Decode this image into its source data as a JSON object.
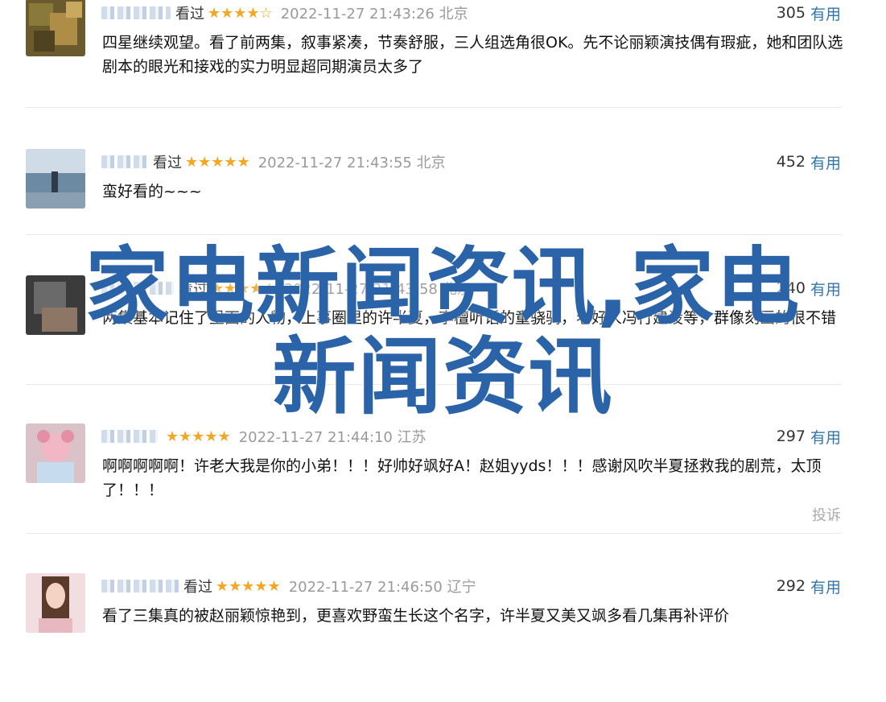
{
  "comments": [
    {
      "watched": "看过",
      "stars": "★★★★☆",
      "time": "2022-11-27 21:43:26 北京",
      "votes": "305",
      "useful": "有用",
      "text": "四星继续观望。看了前两集，叙事紧凑，节奏舒服，三人组选角很OK。先不论丽颖演技偶有瑕疵，她和团队选剧本的眼光和接戏的实力明显超同期演员太多了"
    },
    {
      "watched": "看过",
      "stars": "★★★★★",
      "time": "2022-11-27 21:43:55 北京",
      "votes": "452",
      "useful": "有用",
      "text": "蛮好看的~~~"
    },
    {
      "watched": "看过",
      "stars": "★★★★★",
      "time": "2022-11-27 21:43:58 北京",
      "votes": "240",
      "useful": "有用",
      "text": "两集基本记住了里面的人物，上事圈里的许半夏，李檀听话的童骁骑，老好人冯行建设等，群像刻画的很不错"
    },
    {
      "watched": "",
      "stars": "★★★★★",
      "time": "2022-11-27 21:44:10 江苏",
      "votes": "297",
      "useful": "有用",
      "text": "啊啊啊啊啊！许老大我是你的小弟！！！好帅好飒好A！赵姐yyds！！！感谢风吹半夏拯救我的剧荒，太顶了！！！",
      "report": "投诉"
    },
    {
      "watched": "看过",
      "stars": "★★★★★",
      "time": "2022-11-27 21:46:50 辽宁",
      "votes": "292",
      "useful": "有用",
      "text": "看了三集真的被赵丽颖惊艳到，更喜欢野蛮生长这个名字，许半夏又美又飒多看几集再补评价"
    }
  ],
  "overlay": {
    "line1": "家电新闻资讯,家电",
    "line2": "新闻资讯"
  },
  "colors": {
    "star": "#f5a623",
    "link": "#3377aa",
    "overlay": "#2a63a8"
  }
}
